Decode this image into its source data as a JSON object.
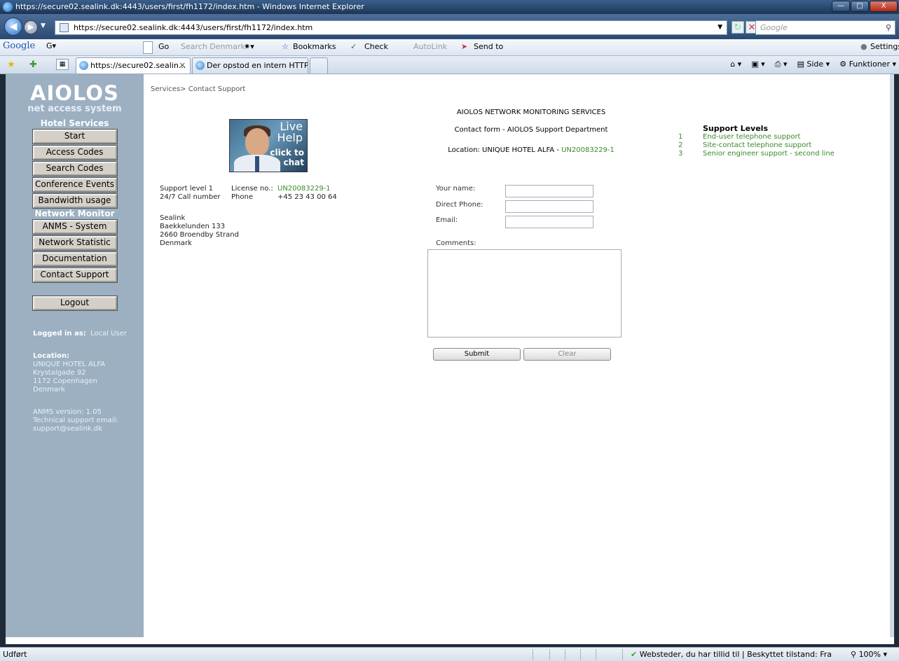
{
  "window": {
    "title": "https://secure02.sealink.dk:4443/users/first/fh1172/index.htm - Windows Internet Explorer",
    "min": "—",
    "max": "□",
    "close": "X"
  },
  "address_bar": {
    "url": "https://secure02.sealink.dk:4443/users/first/fh1172/index.htm",
    "search_placeholder": "Google"
  },
  "google_toolbar": {
    "logo": "Google",
    "go": "Go",
    "search_denmark": "Search Denmark",
    "bookmarks": "Bookmarks",
    "check": "Check",
    "autolink": "AutoLink",
    "send_to": "Send to",
    "settings": "Settings"
  },
  "tabs": [
    {
      "label": "https://secure02.sealin...",
      "active": true
    },
    {
      "label": "Der opstod en intern HTTP...",
      "active": false
    }
  ],
  "command_bar": {
    "side": "Side",
    "funktioner": "Funktioner"
  },
  "sidebar": {
    "brand": "AIOLOS",
    "brand_sub": "net access system",
    "hotel_head": "Hotel Services",
    "hotel_items": [
      "Start",
      "Access Codes",
      "Search Codes",
      "Conference Events",
      "Bandwidth usage"
    ],
    "network_head": "Network Monitor",
    "network_items": [
      "ANMS - System",
      "Network Statistic",
      "Documentation",
      "Contact Support"
    ],
    "logout": "Logout",
    "logged_in_label": "Logged in as:",
    "logged_in_user": "Local User",
    "location_label": "Location:",
    "location_lines": [
      "UNIQUE HOTEL ALFA",
      "Krystalgade 92",
      "1172 Copenhagen",
      "Denmark"
    ],
    "version": "ANMS version: 1.05",
    "support_label": "Technical support email:",
    "support_email": "support@sealink.dk"
  },
  "breadcrumb": "Services> Contact Support",
  "live_help": {
    "line1": "Live",
    "line2": "Help",
    "line3": "click to",
    "line4": "chat"
  },
  "contact": {
    "support_level": "Support level 1",
    "call_number": "24/7 Call number",
    "license_label": "License no.:",
    "license_value": "UN20083229-1",
    "phone_label": "Phone",
    "phone_value": "+45 23 43 00 64",
    "address": [
      "Sealink",
      "Baekkelunden 133",
      "2660 Broendby Strand",
      "Denmark"
    ]
  },
  "form": {
    "heading": "AIOLOS NETWORK MONITORING SERVICES",
    "subheading": "Contact form - AIOLOS Support Department",
    "location_label": "Location: UNIQUE HOTEL ALFA - ",
    "location_code": "UN20083229-1",
    "name_label": "Your name:",
    "phone_label": "Direct Phone:",
    "email_label": "Email:",
    "comments_label": "Comments:",
    "submit": "Submit",
    "clear": "Clear"
  },
  "support_levels": {
    "title": "Support Levels",
    "items": [
      {
        "num": "1",
        "text": "End-user telephone support"
      },
      {
        "num": "2",
        "text": "Site-contact telephone support"
      },
      {
        "num": "3",
        "text": "Senior engineer support -  second line"
      }
    ]
  },
  "status": {
    "left": "Udført",
    "security": "Websteder, du har tillid til | Beskyttet tilstand: Fra",
    "zoom": "100%"
  }
}
